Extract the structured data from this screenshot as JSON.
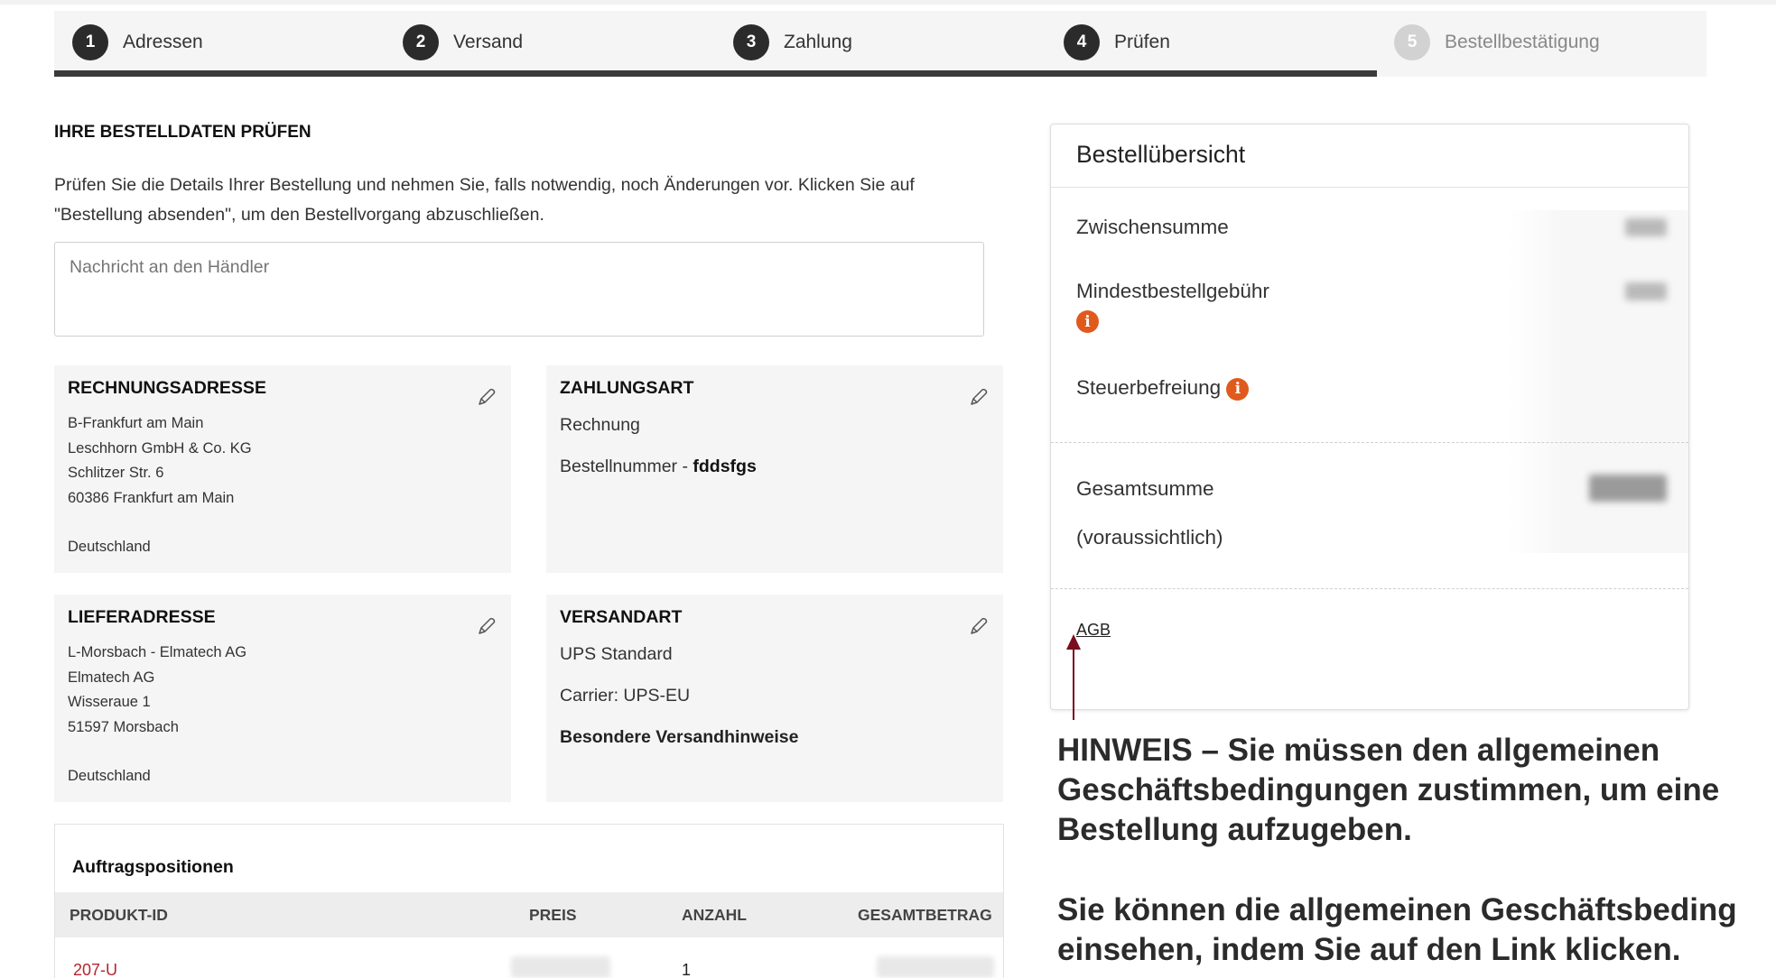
{
  "stepper": {
    "steps": [
      {
        "num": "1",
        "label": "Adressen"
      },
      {
        "num": "2",
        "label": "Versand"
      },
      {
        "num": "3",
        "label": "Zahlung"
      },
      {
        "num": "4",
        "label": "Prüfen"
      },
      {
        "num": "5",
        "label": "Bestellbestätigung"
      }
    ],
    "progress_completed_steps": 4
  },
  "review": {
    "title": "IHRE BESTELLDATEN PRÜFEN",
    "intro": "Prüfen Sie die Details Ihrer Bestellung und nehmen Sie, falls notwendig, noch Änderungen vor. Klicken Sie auf \"Bestellung absenden\", um den Bestellvorgang abzuschließen.",
    "message_placeholder": "Nachricht an den Händler"
  },
  "billing": {
    "title": "RECHNUNGSADRESSE",
    "lines": [
      "B-Frankfurt am Main",
      "Leschhorn GmbH & Co. KG",
      "Schlitzer Str. 6",
      "60386  Frankfurt am Main"
    ],
    "country": "Deutschland"
  },
  "payment": {
    "title": "ZAHLUNGSART",
    "method": "Rechnung",
    "order_number_label": "Bestellnummer - ",
    "order_number": "fddsfgs"
  },
  "shipping_address": {
    "title": "LIEFERADRESSE",
    "lines": [
      "L-Morsbach - Elmatech AG",
      "Elmatech AG",
      "Wisseraue 1",
      "51597  Morsbach"
    ],
    "country": "Deutschland"
  },
  "shipping_method": {
    "title": "VERSANDART",
    "method": "UPS Standard",
    "carrier": "Carrier: UPS-EU",
    "notes": "Besondere Versandhinweise"
  },
  "items": {
    "title": "Auftragspositionen",
    "columns": [
      "PRODUKT-ID",
      "PREIS",
      "ANZAHL",
      "GESAMTBETRAG"
    ],
    "rows": [
      {
        "product_id": "207-U",
        "quantity": "1"
      }
    ]
  },
  "summary": {
    "title": "Bestellübersicht",
    "subtotal_label": "Zwischensumme",
    "min_fee_label": "Mindestbestellgebühr",
    "tax_exempt_label": "Steuerbefreiung",
    "total_label": "Gesamtsumme",
    "total_sub_label": "(voraussichtlich)",
    "agb_link": "AGB"
  },
  "annotation": {
    "lines": [
      "HINWEIS – Sie müssen den allgemeinen",
      "Geschäftsbedingungen zustimmen, um eine",
      "Bestellung aufzugeben.",
      "",
      "Sie können die allgemeinen Geschäftsbeding",
      "einsehen, indem Sie auf den Link klicken."
    ]
  },
  "colors": {
    "accent_link": "#b3262e",
    "info_icon": "#e05a1c",
    "arrow": "#7a0d1d",
    "step_active": "#2b2b2b",
    "step_inactive": "#d2d2d2"
  }
}
